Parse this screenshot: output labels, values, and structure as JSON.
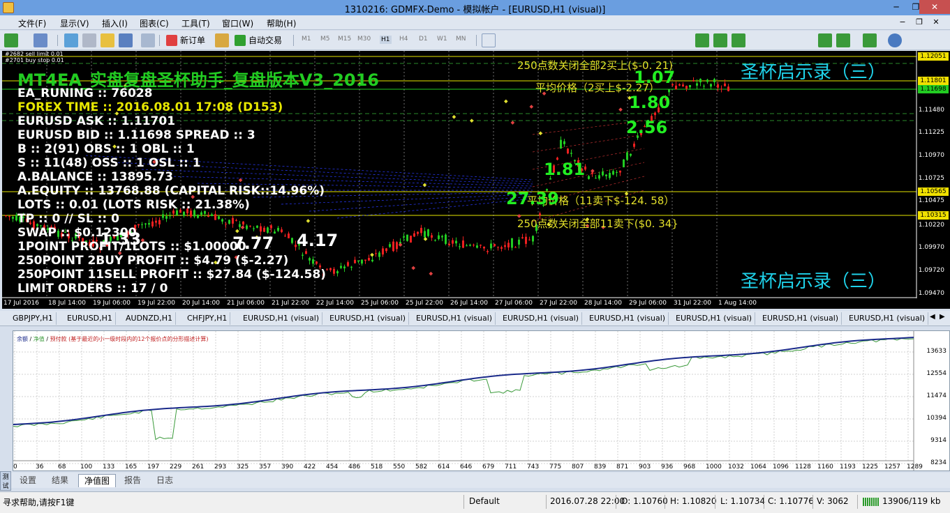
{
  "window": {
    "title": "1310216: GDMFX-Demo - 模拟帐户 - [EURUSD,H1 (visual)]",
    "min": "─",
    "restore": "❐",
    "close": "✕"
  },
  "menu": {
    "items": [
      "文件(F)",
      "显示(V)",
      "插入(I)",
      "图表(C)",
      "工具(T)",
      "窗口(W)",
      "帮助(H)"
    ],
    "child_min": "−",
    "child_restore": "❐",
    "child_close": "✕"
  },
  "toolbar": {
    "new_order": "新订单",
    "auto_trade": "自动交易",
    "timeframes": [
      "M1",
      "M5",
      "M15",
      "M30",
      "H1",
      "H4",
      "D1",
      "W1",
      "MN"
    ]
  },
  "chart": {
    "pending_labels": [
      "#2682 sell limit 0.01",
      "#2701 buy stop 0.01"
    ],
    "ea_title": "MT4EA_实盘复盘圣杯助手_复盘版本V3_2016",
    "info_lines": [
      "EA_RUNING :: 76028",
      "FOREX TIME :: 2016.08.01 17:08 (D153)",
      "EURUSD ASK :: 1.11701",
      "EURUSD BID :: 1.11698   SPREAD :: 3",
      "B :: 2(91)  OBS :: 1  OBL :: 1",
      "S :: 11(48)  OSS :: 1  OSL :: 1",
      "A.BALANCE :: 13895.73",
      "A.EQUITY :: 13768.88  (CAPITAL RISK::14.96%)",
      "LOTS :: 0.01  (LOTS RISK :: 21.38%)",
      "TP :: 0 // SL :: 0",
      "SWAP :: $0.12300",
      "1POINT PROFIT/1LOTS :: $1.00000",
      "250POINT 2BUY PROFIT :: $4.79 ($-2.27)",
      "250POINT 11SELL PROFIT :: $27.84 ($-124.58)",
      "LIMIT ORDERS :: 17 / 0"
    ],
    "cn_labels": {
      "close_buy": "250点数关闭全部2买上($-0. 21)",
      "avg_buy": "平均价格（2买上$-2.27）",
      "avg_sell": "平均价格（11卖下$-124. 58）",
      "close_sell": "250点数关闭全部11卖下($0. 34}",
      "brand": "圣杯启示录（三）"
    },
    "big_numbers": [
      "1.07",
      "1.80",
      "2.56",
      "1.81",
      "27.39",
      "1.33",
      "7.77",
      "4.17"
    ],
    "price_levels": [
      {
        "v": "1.12051",
        "bg": "#f0e000"
      },
      {
        "v": "1.11801",
        "bg": "#f0e000"
      },
      {
        "v": "1.11698",
        "bg": "#22cc22"
      },
      {
        "v": "1.10565",
        "bg": "#f0e000"
      },
      {
        "v": "1.10315",
        "bg": "#f0e000"
      }
    ],
    "price_ticks": [
      "1.11480",
      "1.11225",
      "1.10970",
      "1.10725",
      "1.10475",
      "1.10220",
      "1.09970",
      "1.09720",
      "1.09470"
    ],
    "time_ticks": [
      "17 Jul 2016",
      "18 Jul 14:00",
      "19 Jul 06:00",
      "19 Jul 22:00",
      "20 Jul 14:00",
      "21 Jul 06:00",
      "21 Jul 22:00",
      "22 Jul 14:00",
      "25 Jul 06:00",
      "25 Jul 22:00",
      "26 Jul 14:00",
      "27 Jul 06:00",
      "27 Jul 22:00",
      "28 Jul 14:00",
      "29 Jul 06:00",
      "31 Jul 22:00",
      "1 Aug 14:00"
    ]
  },
  "chart_tabs": [
    "GBPJPY,H1",
    "EURUSD,H1",
    "AUDNZD,H1",
    "CHFJPY,H1",
    "EURUSD,H1 (visual)",
    "EURUSD,H1 (visual)",
    "EURUSD,H1 (visual)",
    "EURUSD,H1 (visual)",
    "EURUSD,H1 (visual)",
    "EURUSD,H1 (visual)",
    "EURUSD,H1 (visual)",
    "EURUSD,H1 (visual)"
  ],
  "equity": {
    "legend_a": "余额",
    "legend_b": "净值",
    "legend_c": "预付款 (基于最近的小一级时段内的12个报价点的分形描述计算)",
    "y_ticks": [
      "13633",
      "12554",
      "11474",
      "10394",
      "9314",
      "8234"
    ],
    "x_ticks": [
      "0",
      "36",
      "68",
      "100",
      "133",
      "165",
      "197",
      "229",
      "261",
      "293",
      "325",
      "357",
      "390",
      "422",
      "454",
      "486",
      "518",
      "550",
      "582",
      "614",
      "646",
      "679",
      "711",
      "743",
      "775",
      "807",
      "839",
      "871",
      "903",
      "936",
      "968",
      "1000",
      "1032",
      "1064",
      "1096",
      "1128",
      "1160",
      "1193",
      "1225",
      "1257",
      "1289"
    ]
  },
  "side_tab": "测试器",
  "bottom_tabs": [
    "设置",
    "结果",
    "净值图",
    "报告",
    "日志"
  ],
  "status": {
    "help": "寻求帮助,请按F1键",
    "profile": "Default",
    "datetime": "2016.07.28 22:00",
    "open": "O: 1.10760",
    "high": "H: 1.10820",
    "low": "L: 1.10734",
    "close": "C: 1.10776",
    "volume": "V: 3062",
    "traffic": "13906/119 kb"
  }
}
